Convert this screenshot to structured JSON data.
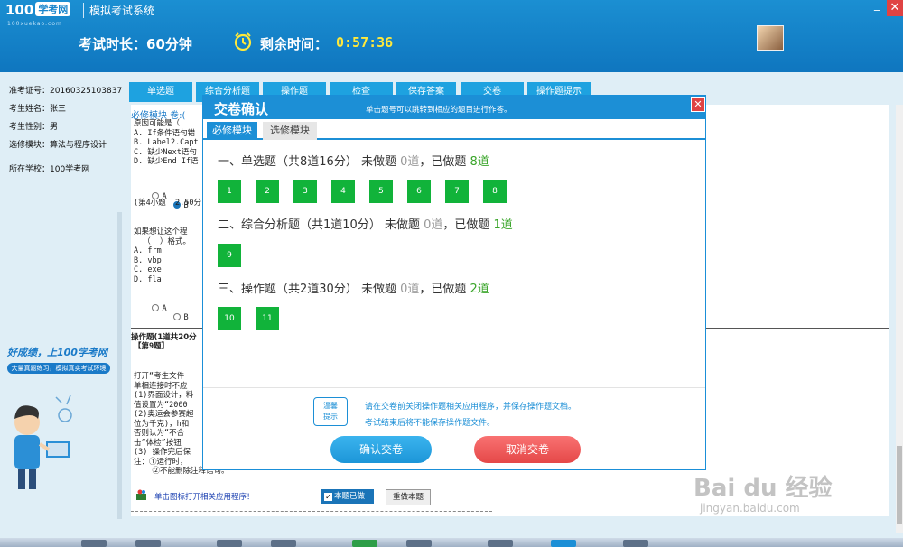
{
  "header": {
    "logo": "100",
    "logo_box": "学考网",
    "site_sub": "100xuekao.com",
    "app_title": "模拟考试系统",
    "exam_duration": "考试时长：60分钟",
    "remaining_label": "剩余时间：",
    "remaining_time": "0:57:36",
    "min_glyph": "_",
    "close_glyph": "✕"
  },
  "candidate": {
    "id": "准考证号：20160325103837",
    "name": "考生姓名：张三",
    "gender": "考生性别：男",
    "module": "选修模块：算法与程序设计",
    "school": "所在学校：100学考网"
  },
  "promo": {
    "title": "好成绩，上100学考网",
    "sub": "大量真题练习，模拟真实考试环境"
  },
  "toolbar": {
    "items": [
      "单选题",
      "综合分析题",
      "操作题",
      "检查",
      "保存答案",
      "交卷",
      "操作题提示"
    ]
  },
  "main": {
    "section_label": "必修模块 卷:(",
    "q3_lines": "原因可能是（\nA. If条件语句错\nB. Label2.Capt\nC. 缺少Next语句\nD. 缺少End If语",
    "q3_options": [
      "A",
      "B"
    ],
    "q4_meta": "(第4小题  2.50分",
    "q4_lines": "如果想让这个程\n  （  ）格式。\nA. frm\nB. vbp\nC. exe\nD. fla",
    "q4_options": [
      "A",
      "B"
    ],
    "op_header": "操作题(1道共20分",
    "op_no": "【第9题】",
    "op_lines": "打开“考生文件\n单相连接时不应\n(1)界面设计，料\n值设置为“2000\n(2)奥运会参赛超\n位为千克)，h和\n否则认为“不合\n击“体检”按钮\n(3) 操作完后保\n注：①运行时，\n    ②不能删除注释语句。",
    "open_prog_text": "单击图标打开相关应用程序！",
    "done_label": "本题已做",
    "redo_label": "重做本题"
  },
  "modal": {
    "title": "交卷确认",
    "hint": "单击题号可以跳转到相应的题目进行作答。",
    "close_glyph": "✕",
    "tabs": [
      "必修模块",
      "选修模块"
    ],
    "sections": [
      {
        "title": "一、单选题（共8道16分）  未做题 ",
        "undone": "0道",
        "sep": "，已做题 ",
        "done": "8道",
        "questions": [
          "1",
          "2",
          "3",
          "4",
          "5",
          "6",
          "7",
          "8"
        ]
      },
      {
        "title": "二、综合分析题（共1道10分）  未做题 ",
        "undone": "0道",
        "sep": "，已做题 ",
        "done": "1道",
        "questions": [
          "9"
        ]
      },
      {
        "title": "三、操作题（共2道30分）  未做题 ",
        "undone": "0道",
        "sep": "，已做题 ",
        "done": "2道",
        "questions": [
          "10",
          "11"
        ]
      }
    ],
    "tip_badge": "温馨\n提示",
    "tip_line1": "请在交卷前关闭操作题相关应用程序，并保存操作题文档。",
    "tip_line2": "考试结束后将不能保存操作题文件。",
    "confirm_label": "确认交卷",
    "cancel_label": "取消交卷"
  },
  "watermark": {
    "brand": "Bai du 经验",
    "url": "jingyan.baidu.com"
  },
  "colors": {
    "header_blue": "#1b8fd2",
    "answered_green": "#11b33a",
    "cancel_red": "#e54848",
    "time_yellow": "#ffe93b"
  }
}
